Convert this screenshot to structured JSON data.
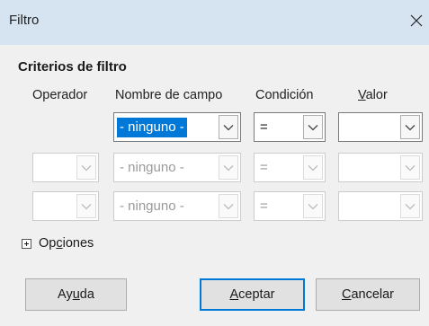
{
  "window": {
    "title": "Filtro"
  },
  "section": {
    "title": "Criterios de filtro"
  },
  "headers": {
    "operator": "Operador",
    "field": "Nombre de campo",
    "condition": "Condición",
    "value_prefix": "",
    "value_mnemonic": "V",
    "value_rest": "alor"
  },
  "rows": [
    {
      "operator": "",
      "field": "- ninguno -",
      "condition": "=",
      "value": "",
      "enabled": true
    },
    {
      "operator": "",
      "field": "- ninguno -",
      "condition": "=",
      "value": "",
      "enabled": false
    },
    {
      "operator": "",
      "field": "- ninguno -",
      "condition": "=",
      "value": "",
      "enabled": false
    }
  ],
  "options": {
    "prefix": "Op",
    "mnemonic": "c",
    "rest": "iones"
  },
  "buttons": {
    "help": {
      "prefix": "Ay",
      "mnemonic": "u",
      "rest": "da"
    },
    "ok": {
      "prefix": "",
      "mnemonic": "A",
      "rest": "ceptar"
    },
    "cancel": {
      "prefix": "",
      "mnemonic": "C",
      "rest": "ancelar"
    }
  },
  "icons": {
    "close": "close-icon",
    "dropdown": "chevron-down-icon",
    "expand": "plus-box-icon"
  },
  "colors": {
    "titlebar": "#d6e4f2",
    "selection": "#0078d7",
    "dialog_bg": "#f0f0f0"
  }
}
